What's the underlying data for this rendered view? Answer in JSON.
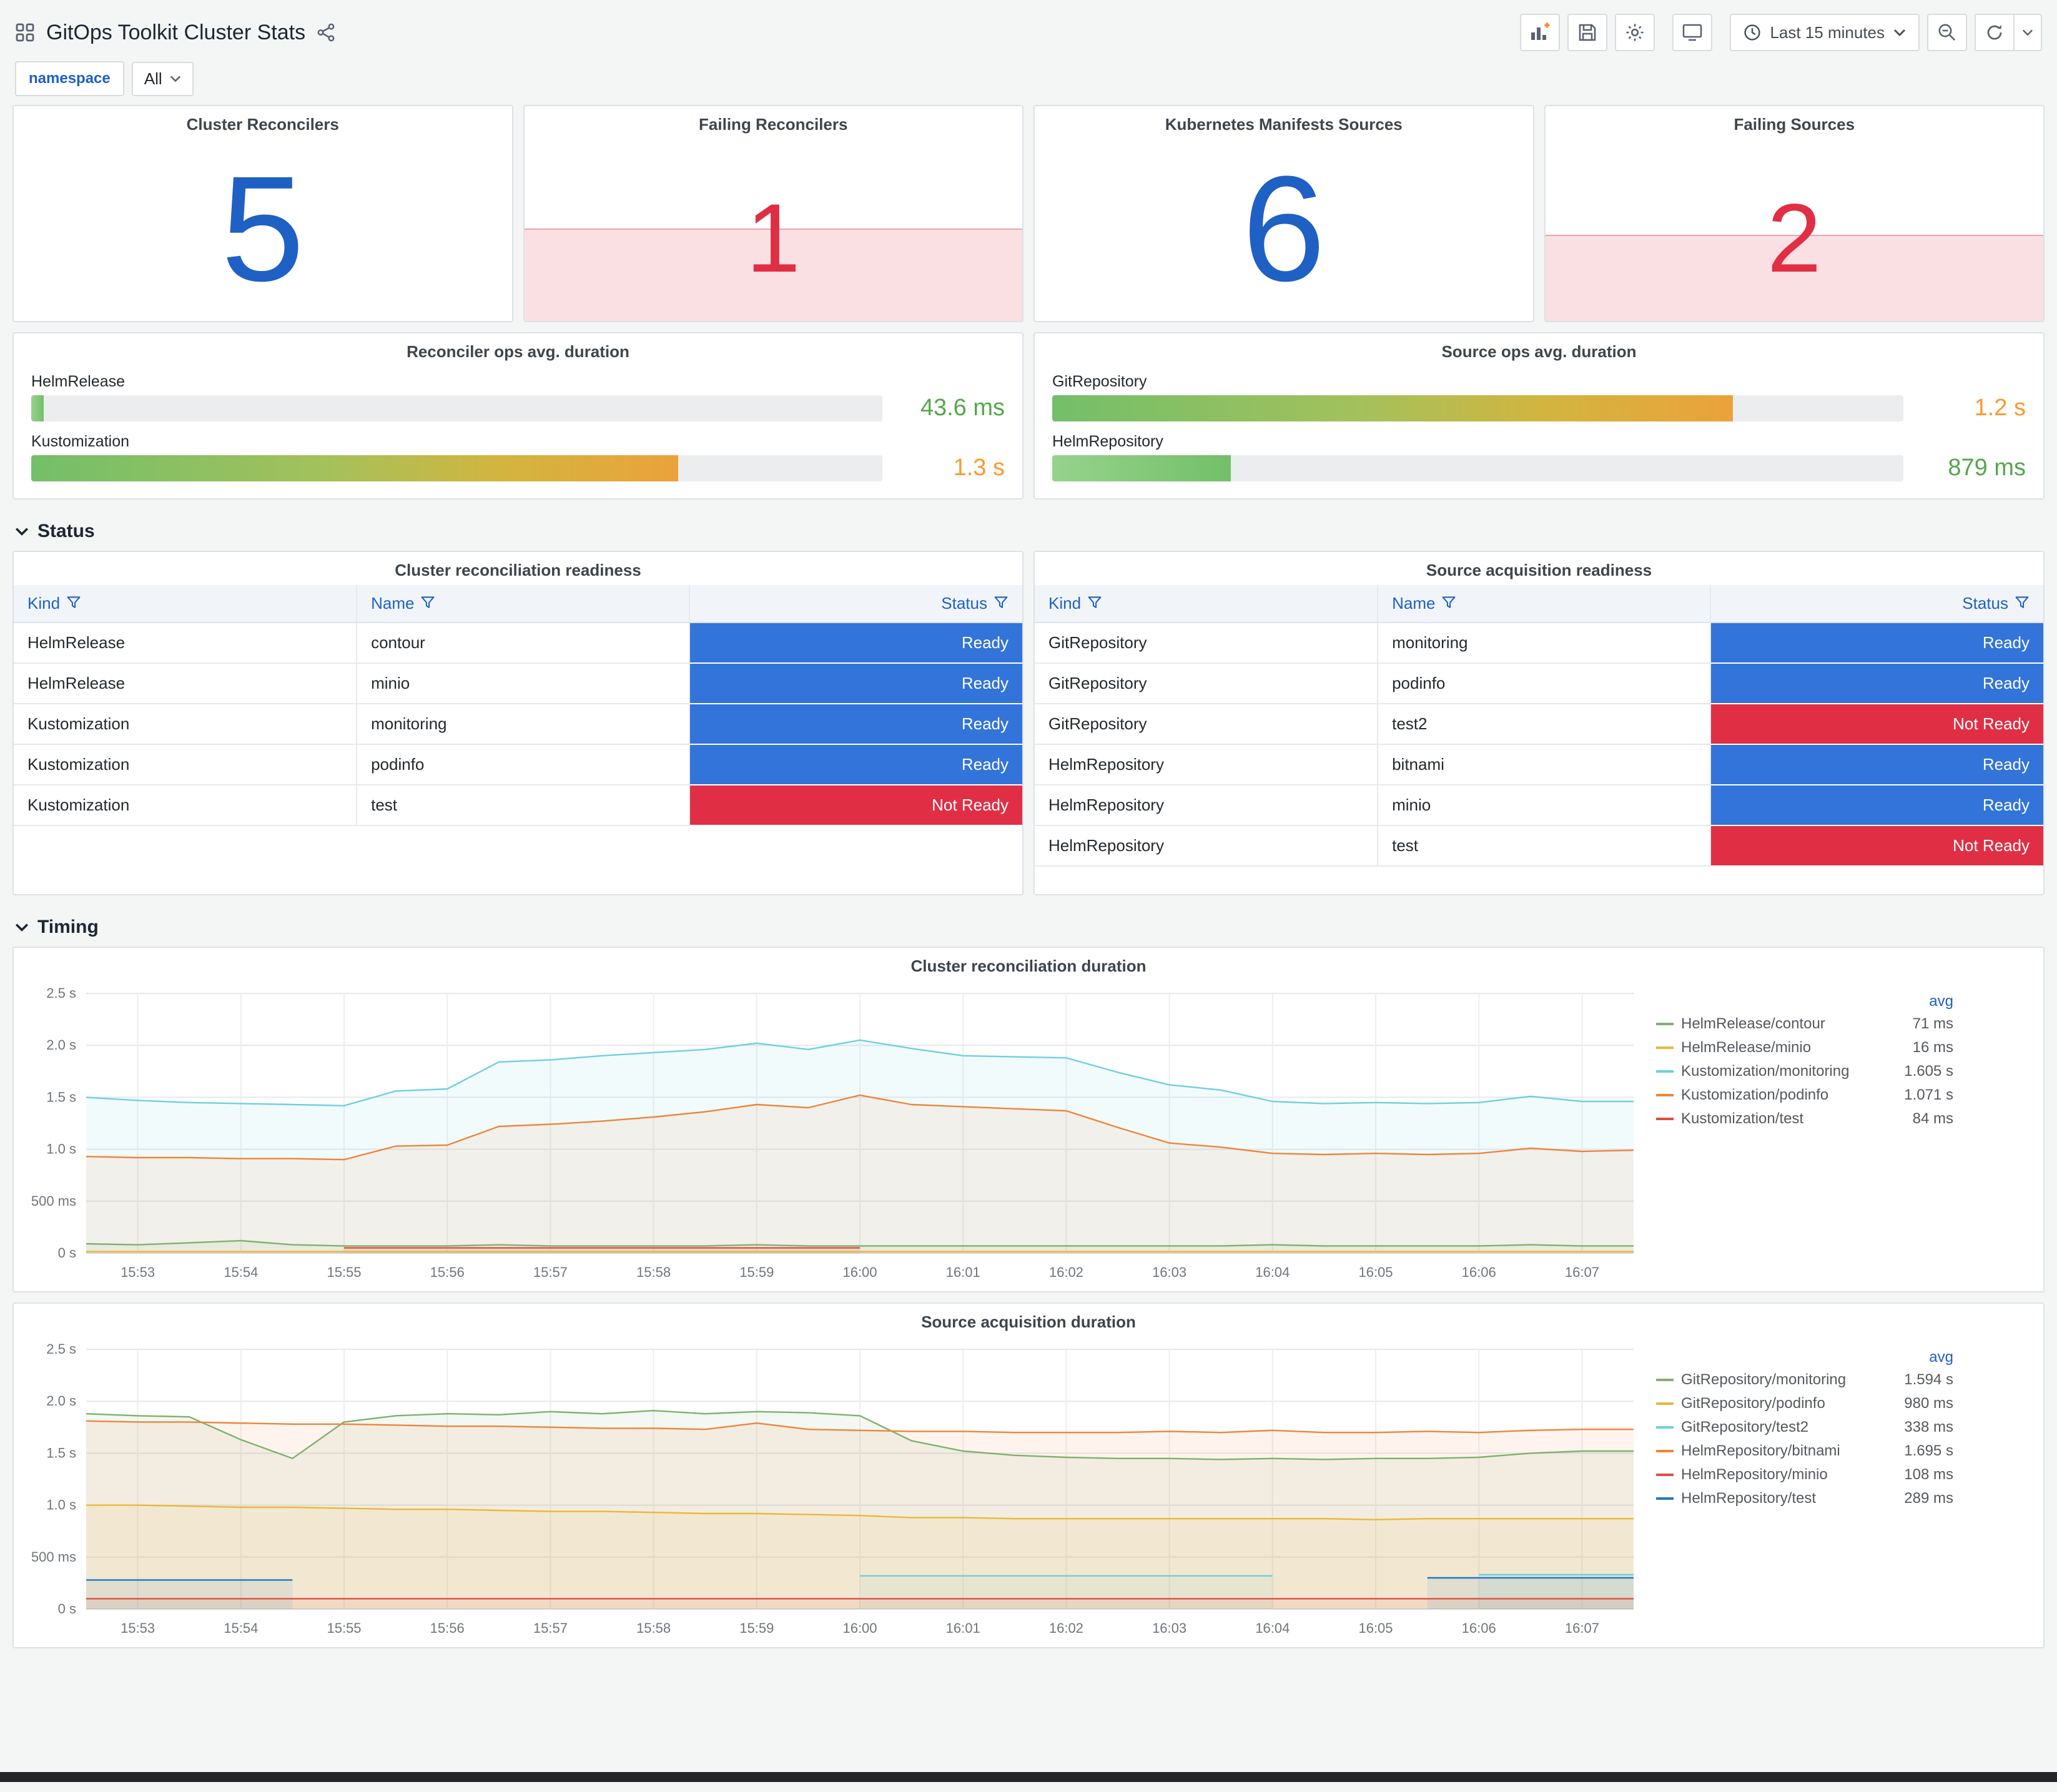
{
  "header": {
    "title": "GitOps Toolkit Cluster Stats",
    "time_range_label": "Last 15 minutes"
  },
  "filters": {
    "label": "namespace",
    "value": "All"
  },
  "sections": {
    "status": "Status",
    "timing": "Timing"
  },
  "icons": {
    "topbar_left": [
      "dashboard-grid-icon",
      "share-icon"
    ],
    "topbar_right": [
      "add-panel-icon",
      "save-dashboard-icon",
      "dashboard-settings-icon",
      "cycle-view-icon",
      "clock-icon",
      "caret-down-icon",
      "zoom-out-icon",
      "refresh-icon",
      "caret-down-icon"
    ],
    "table_header": [
      "filter-icon"
    ],
    "section_header": [
      "chevron-down-icon"
    ]
  },
  "stats": [
    {
      "title": "Cluster Reconcilers",
      "value": "5",
      "color": "#1F60C4",
      "alert": false
    },
    {
      "title": "Failing Reconcilers",
      "value": "1",
      "color": "#E02F44",
      "alert": true,
      "fill_pct": 43
    },
    {
      "title": "Kubernetes Manifests Sources",
      "value": "6",
      "color": "#1F60C4",
      "alert": false
    },
    {
      "title": "Failing Sources",
      "value": "2",
      "color": "#E02F44",
      "alert": true,
      "fill_pct": 40
    }
  ],
  "gauges": [
    {
      "title": "Reconciler ops avg. duration",
      "rows": [
        {
          "label": "HelmRelease",
          "value": "43.6 ms",
          "pct": 1.5,
          "style": "green",
          "value_color": "#56A64B"
        },
        {
          "label": "Kustomization",
          "value": "1.3 s",
          "pct": 76,
          "style": "gradient",
          "value_color": "#FF9830"
        }
      ]
    },
    {
      "title": "Source ops avg. duration",
      "rows": [
        {
          "label": "GitRepository",
          "value": "1.2 s",
          "pct": 80,
          "style": "gradient",
          "value_color": "#FF9830"
        },
        {
          "label": "HelmRepository",
          "value": "879 ms",
          "pct": 21,
          "style": "green",
          "value_color": "#56A64B"
        }
      ]
    }
  ],
  "status_colors": {
    "Ready": "#3274D9",
    "Not Ready": "#E02F44"
  },
  "tables": [
    {
      "title": "Cluster reconciliation readiness",
      "columns": [
        "Kind",
        "Name",
        "Status"
      ],
      "rows": [
        [
          "HelmRelease",
          "contour",
          "Ready"
        ],
        [
          "HelmRelease",
          "minio",
          "Ready"
        ],
        [
          "Kustomization",
          "monitoring",
          "Ready"
        ],
        [
          "Kustomization",
          "podinfo",
          "Ready"
        ],
        [
          "Kustomization",
          "test",
          "Not Ready"
        ]
      ]
    },
    {
      "title": "Source acquisition readiness",
      "columns": [
        "Kind",
        "Name",
        "Status"
      ],
      "rows": [
        [
          "GitRepository",
          "monitoring",
          "Ready"
        ],
        [
          "GitRepository",
          "podinfo",
          "Ready"
        ],
        [
          "GitRepository",
          "test2",
          "Not Ready"
        ],
        [
          "HelmRepository",
          "bitnami",
          "Ready"
        ],
        [
          "HelmRepository",
          "minio",
          "Ready"
        ],
        [
          "HelmRepository",
          "test",
          "Not Ready"
        ]
      ]
    }
  ],
  "chart_data": [
    {
      "type": "line",
      "title": "Cluster reconciliation duration",
      "legend_header": "avg",
      "legend_position": "right",
      "grid": true,
      "ylim": [
        0,
        2.5
      ],
      "y_ticks": [
        {
          "v": 0,
          "label": "0 s"
        },
        {
          "v": 0.5,
          "label": "500 ms"
        },
        {
          "v": 1.0,
          "label": "1.0 s"
        },
        {
          "v": 1.5,
          "label": "1.5 s"
        },
        {
          "v": 2.0,
          "label": "2.0 s"
        },
        {
          "v": 2.5,
          "label": "2.5 s"
        }
      ],
      "x_domain": 15,
      "x_ticks": [
        "15:53",
        "15:54",
        "15:55",
        "15:56",
        "15:57",
        "15:58",
        "15:59",
        "16:00",
        "16:01",
        "16:02",
        "16:03",
        "16:04",
        "16:05",
        "16:06",
        "16:07"
      ],
      "series": [
        {
          "name": "HelmRelease/contour",
          "color": "#7EB26D",
          "avg": "71 ms",
          "values": [
            0.09,
            0.08,
            0.1,
            0.12,
            0.08,
            0.07,
            0.07,
            0.07,
            0.08,
            0.07,
            0.07,
            0.07,
            0.07,
            0.08,
            0.07,
            0.07,
            0.07,
            0.07,
            0.07,
            0.07,
            0.07,
            0.07,
            0.07,
            0.08,
            0.07,
            0.07,
            0.07,
            0.07,
            0.08,
            0.07,
            0.07
          ]
        },
        {
          "name": "HelmRelease/minio",
          "color": "#EAB839",
          "avg": "16 ms",
          "values": [
            0.016,
            0.016,
            0.016,
            0.016,
            0.016,
            0.016,
            0.016,
            0.016,
            0.016,
            0.016,
            0.016,
            0.016,
            0.016,
            0.016,
            0.016,
            0.016,
            0.016,
            0.016,
            0.016,
            0.016,
            0.016,
            0.016,
            0.016,
            0.016,
            0.016,
            0.016,
            0.016,
            0.016,
            0.016,
            0.016,
            0.016
          ]
        },
        {
          "name": "Kustomization/monitoring",
          "color": "#6ED0E0",
          "avg": "1.605 s",
          "values": [
            1.5,
            1.47,
            1.45,
            1.44,
            1.43,
            1.42,
            1.56,
            1.58,
            1.84,
            1.86,
            1.9,
            1.93,
            1.96,
            2.02,
            1.96,
            2.05,
            1.97,
            1.9,
            1.89,
            1.88,
            1.74,
            1.62,
            1.57,
            1.46,
            1.44,
            1.45,
            1.44,
            1.45,
            1.51,
            1.46,
            1.46
          ]
        },
        {
          "name": "Kustomization/podinfo",
          "color": "#EF843C",
          "avg": "1.071 s",
          "values": [
            0.93,
            0.92,
            0.92,
            0.91,
            0.91,
            0.9,
            1.03,
            1.04,
            1.22,
            1.24,
            1.27,
            1.31,
            1.36,
            1.43,
            1.4,
            1.52,
            1.43,
            1.41,
            1.39,
            1.37,
            1.21,
            1.06,
            1.02,
            0.96,
            0.95,
            0.96,
            0.95,
            0.96,
            1.01,
            0.98,
            0.99
          ]
        },
        {
          "name": "Kustomization/test",
          "color": "#E24D42",
          "avg": "84 ms",
          "values": [
            null,
            null,
            null,
            null,
            null,
            0.05,
            0.05,
            0.05,
            0.05,
            0.05,
            0.05,
            0.05,
            0.05,
            0.05,
            0.05,
            0.05,
            null,
            null,
            null,
            null,
            null,
            null,
            null,
            null,
            null,
            null,
            null,
            null,
            null,
            null,
            null
          ]
        }
      ]
    },
    {
      "type": "line",
      "title": "Source acquisition duration",
      "legend_header": "avg",
      "legend_position": "right",
      "grid": true,
      "ylim": [
        0,
        2.5
      ],
      "y_ticks": [
        {
          "v": 0,
          "label": "0 s"
        },
        {
          "v": 0.5,
          "label": "500 ms"
        },
        {
          "v": 1.0,
          "label": "1.0 s"
        },
        {
          "v": 1.5,
          "label": "1.5 s"
        },
        {
          "v": 2.0,
          "label": "2.0 s"
        },
        {
          "v": 2.5,
          "label": "2.5 s"
        }
      ],
      "x_domain": 15,
      "x_ticks": [
        "15:53",
        "15:54",
        "15:55",
        "15:56",
        "15:57",
        "15:58",
        "15:59",
        "16:00",
        "16:01",
        "16:02",
        "16:03",
        "16:04",
        "16:05",
        "16:06",
        "16:07"
      ],
      "series": [
        {
          "name": "GitRepository/monitoring",
          "color": "#7EB26D",
          "avg": "1.594 s",
          "values": [
            1.88,
            1.86,
            1.85,
            1.63,
            1.45,
            1.8,
            1.86,
            1.88,
            1.87,
            1.9,
            1.88,
            1.91,
            1.88,
            1.9,
            1.89,
            1.86,
            1.62,
            1.52,
            1.48,
            1.46,
            1.45,
            1.45,
            1.44,
            1.45,
            1.44,
            1.45,
            1.45,
            1.46,
            1.5,
            1.52,
            1.52
          ]
        },
        {
          "name": "GitRepository/podinfo",
          "color": "#EAB839",
          "avg": "980 ms",
          "values": [
            1.0,
            1.0,
            0.99,
            0.98,
            0.98,
            0.97,
            0.96,
            0.96,
            0.95,
            0.94,
            0.94,
            0.93,
            0.92,
            0.92,
            0.91,
            0.9,
            0.88,
            0.88,
            0.87,
            0.87,
            0.87,
            0.87,
            0.87,
            0.87,
            0.87,
            0.86,
            0.87,
            0.87,
            0.87,
            0.87,
            0.87
          ]
        },
        {
          "name": "GitRepository/test2",
          "color": "#6ED0E0",
          "avg": "338 ms",
          "values": [
            null,
            null,
            null,
            null,
            null,
            null,
            null,
            null,
            null,
            null,
            null,
            null,
            null,
            null,
            null,
            0.32,
            0.32,
            0.32,
            0.32,
            0.32,
            0.32,
            0.32,
            0.32,
            0.32,
            null,
            null,
            null,
            0.33,
            0.33,
            0.33,
            0.33
          ]
        },
        {
          "name": "HelmRepository/bitnami",
          "color": "#EF843C",
          "avg": "1.695 s",
          "values": [
            1.81,
            1.8,
            1.8,
            1.79,
            1.78,
            1.78,
            1.77,
            1.76,
            1.76,
            1.75,
            1.74,
            1.74,
            1.73,
            1.79,
            1.73,
            1.72,
            1.71,
            1.71,
            1.7,
            1.7,
            1.7,
            1.71,
            1.7,
            1.72,
            1.7,
            1.7,
            1.71,
            1.7,
            1.72,
            1.73,
            1.73
          ]
        },
        {
          "name": "HelmRepository/minio",
          "color": "#E24D42",
          "avg": "108 ms",
          "values": [
            0.1,
            0.1,
            0.1,
            0.1,
            0.1,
            0.1,
            0.1,
            0.1,
            0.1,
            0.1,
            0.1,
            0.1,
            0.1,
            0.1,
            0.1,
            0.1,
            0.1,
            0.1,
            0.1,
            0.1,
            0.1,
            0.1,
            0.1,
            0.1,
            0.1,
            0.1,
            0.1,
            0.1,
            0.1,
            0.1,
            0.1
          ]
        },
        {
          "name": "HelmRepository/test",
          "color": "#1F78C1",
          "avg": "289 ms",
          "values": [
            0.28,
            0.28,
            0.28,
            0.28,
            0.28,
            null,
            null,
            null,
            null,
            null,
            null,
            null,
            null,
            null,
            null,
            null,
            null,
            null,
            null,
            null,
            null,
            null,
            null,
            null,
            null,
            null,
            0.3,
            0.3,
            0.3,
            0.3,
            0.3
          ]
        }
      ]
    }
  ]
}
